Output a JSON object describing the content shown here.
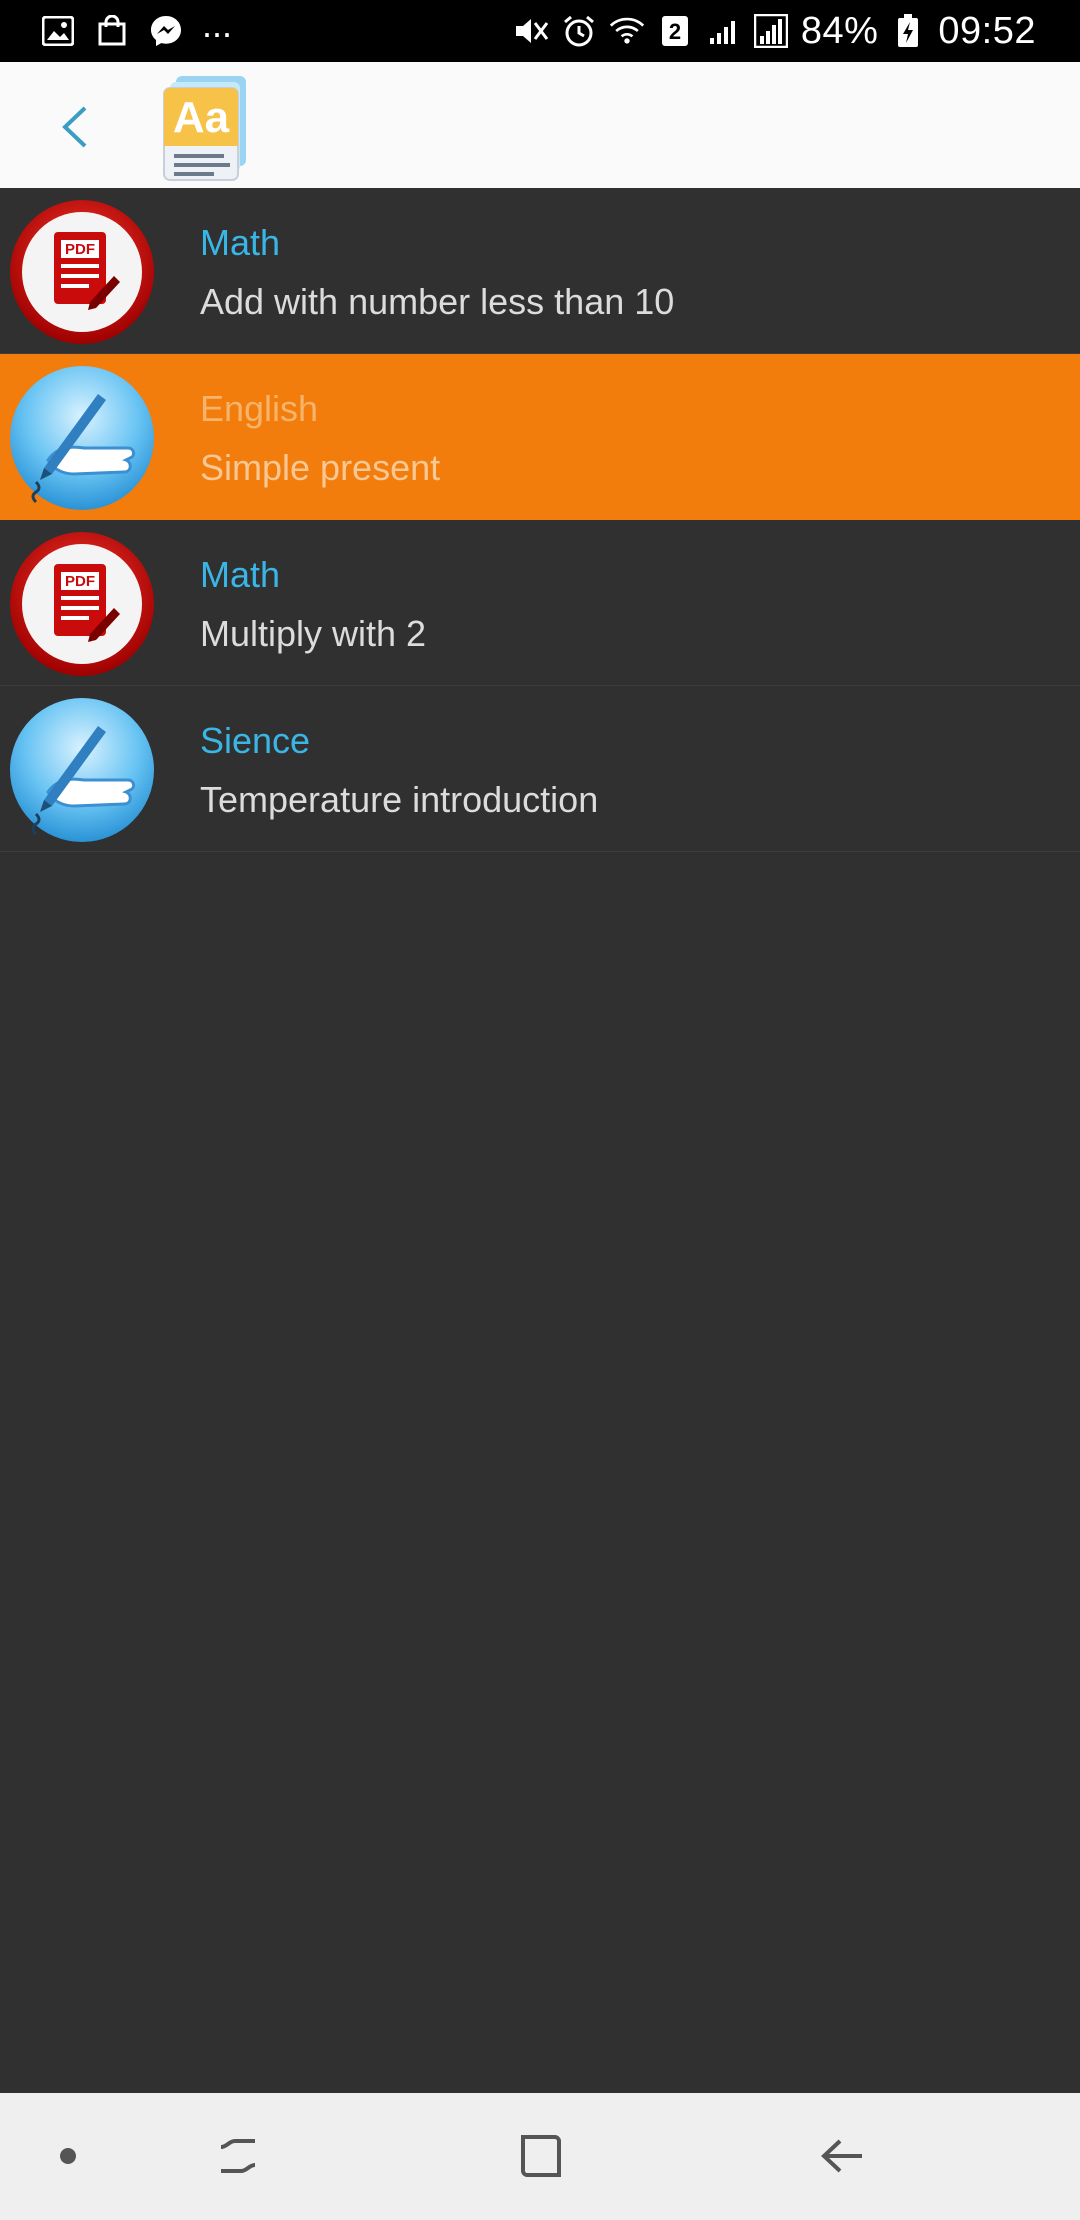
{
  "status_bar": {
    "left_icons": [
      "gallery-icon",
      "shopping-bag-icon",
      "messenger-icon"
    ],
    "overflow": "...",
    "right_icons": [
      "mute-icon",
      "alarm-icon",
      "wifi-icon",
      "sim2-icon",
      "signal-weak-icon",
      "signal-icon",
      "battery-charging-icon"
    ],
    "sim_badge": "2",
    "battery": "84%",
    "time": "09:52"
  },
  "toolbar": {
    "back_icon": "chevron-left-icon",
    "logo_icon": "dictionary-aa-icon",
    "logo_text": "Aa",
    "accent": "#3a9ec4"
  },
  "items": [
    {
      "title": "Math",
      "subtitle": "Add with number less than 10",
      "icon": "pdf-icon",
      "selected": false
    },
    {
      "title": "English",
      "subtitle": "Simple present",
      "icon": "hand-writing-icon",
      "selected": true
    },
    {
      "title": "Math",
      "subtitle": "Multiply with 2",
      "icon": "pdf-icon",
      "selected": false
    },
    {
      "title": "Sience",
      "subtitle": "Temperature introduction",
      "icon": "hand-writing-icon",
      "selected": false
    }
  ],
  "pdf_badge": "PDF",
  "colors": {
    "background": "#303030",
    "selected_row": "#f27c0c",
    "title_blue": "#39b6e6",
    "subtitle_gray": "#dcdcdc"
  },
  "nav_bar": {
    "buttons": [
      "dot-icon",
      "recents-icon",
      "home-icon",
      "back-arrow-icon"
    ]
  }
}
